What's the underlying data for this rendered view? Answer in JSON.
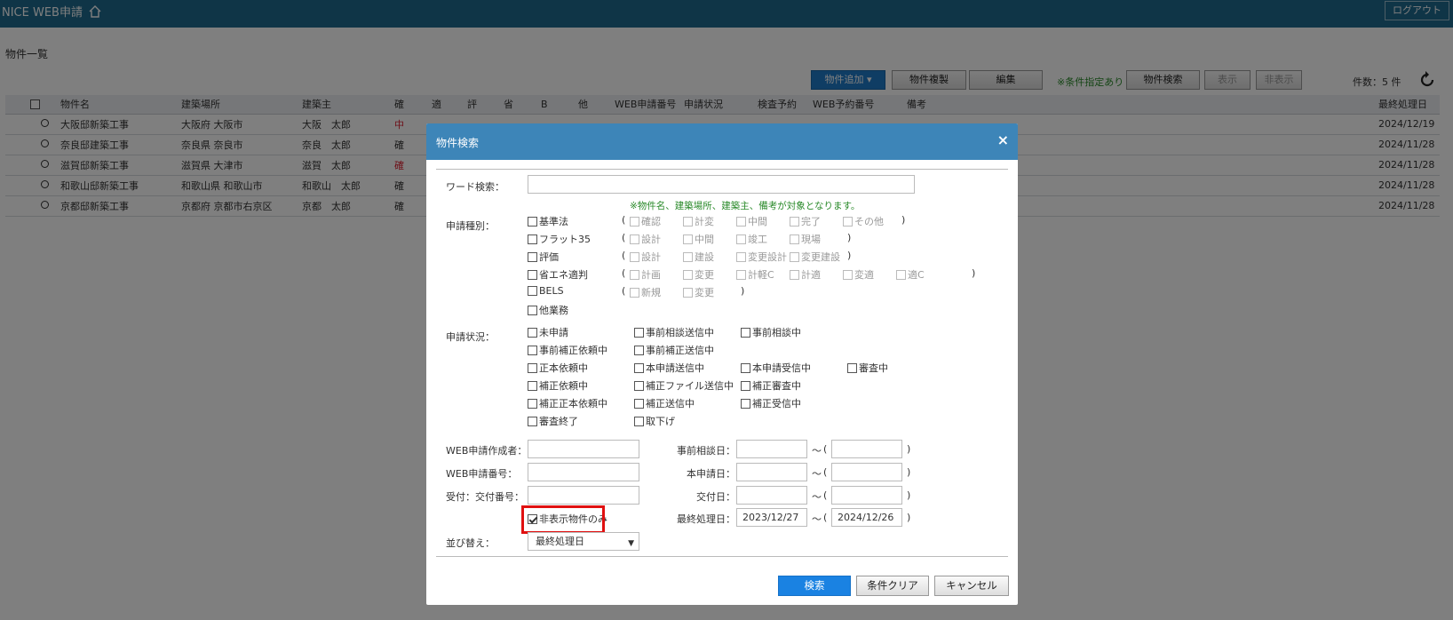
{
  "header": {
    "app_title": "NICE WEB申請",
    "home_icon": "home-icon",
    "logout": "ログアウト"
  },
  "page_title": "物件一覧",
  "toolbar": {
    "add": "物件追加",
    "copy": "物件複製",
    "edit": "編集",
    "condition_note": "※条件指定あり",
    "search": "物件検索",
    "show": "表示",
    "hide": "非表示",
    "count": "件数：5 件",
    "refresh_icon": "refresh-icon"
  },
  "table": {
    "columns": [
      "物件名",
      "建築場所",
      "建築主",
      "確",
      "適",
      "評",
      "省",
      "B",
      "他",
      "WEB申請番号",
      "申請状況",
      "検査予約",
      "WEB予約番号",
      "備考",
      "最終処理日"
    ],
    "rows": [
      {
        "name": "大阪邸新築工事",
        "place": "大阪府 大阪市",
        "owner": "大阪　太郎",
        "kaku": "中",
        "kaku_red": true,
        "date": "2024/12/19"
      },
      {
        "name": "奈良邸建築工事",
        "place": "奈良県 奈良市",
        "owner": "奈良　太郎",
        "kaku": "確",
        "kaku_red": false,
        "date": "2024/11/28"
      },
      {
        "name": "滋賀邸新築工事",
        "place": "滋賀県 大津市",
        "owner": "滋賀　太郎",
        "kaku": "確",
        "kaku_red": true,
        "date": "2024/11/28"
      },
      {
        "name": "和歌山邸新築工事",
        "place": "和歌山県 和歌山市",
        "owner": "和歌山　太郎",
        "kaku": "確",
        "kaku_red": false,
        "date": "2024/11/28"
      },
      {
        "name": "京都邸新築工事",
        "place": "京都府 京都市右京区",
        "owner": "京都　太郎",
        "kaku": "確",
        "kaku_red": false,
        "date": "2024/11/28"
      }
    ]
  },
  "dialog": {
    "title": "物件検索",
    "close": "×",
    "word_search_label": "ワード検索：",
    "word_search_value": "",
    "word_note": "※物件名、建築場所、建築主、備考が対象となります。",
    "app_type_label": "申請種別：",
    "app_types": [
      {
        "label": "基準法",
        "subs": [
          "確認",
          "計変",
          "中間",
          "完了",
          "その他"
        ]
      },
      {
        "label": "フラット35",
        "subs": [
          "設計",
          "中間",
          "竣工",
          "現場"
        ]
      },
      {
        "label": "評価",
        "subs": [
          "設計",
          "建設",
          "変更設計",
          "変更建設"
        ]
      },
      {
        "label": "省エネ適判",
        "subs": [
          "計画",
          "変更",
          "計軽C",
          "計適",
          "変適",
          "適C"
        ]
      },
      {
        "label": "BELS",
        "subs": [
          "新規",
          "変更"
        ]
      },
      {
        "label": "他業務",
        "subs": []
      }
    ],
    "status_label": "申請状況：",
    "statuses": [
      [
        "未申請",
        "事前相談送信中",
        "事前相談中"
      ],
      [
        "事前補正依頼中",
        "事前補正送信中"
      ],
      [
        "正本依頼中",
        "本申請送信中",
        "本申請受信中",
        "審査中"
      ],
      [
        "補正依頼中",
        "補正ファイル送信中",
        "補正審査中"
      ],
      [
        "補正正本依頼中",
        "補正送信中",
        "補正受信中"
      ],
      [
        "審査終了",
        "取下げ"
      ]
    ],
    "creator_label": "WEB申請作成者：",
    "appno_label": "WEB申請番号：",
    "receipt_label": "受付：交付番号：",
    "hidden_only_label": "非表示物件のみ",
    "hidden_only_checked": true,
    "sort_label": "並び替え：",
    "sort_value": "最終処理日",
    "pre_consult_label": "事前相談日：",
    "main_app_label": "本申請日：",
    "issue_label": "交付日：",
    "last_proc_label": "最終処理日：",
    "last_from": "2023/12/27",
    "last_to": "2024/12/26",
    "tilde": "～",
    "open_paren": "(",
    "close_paren": ")",
    "search_btn": "検索",
    "clear_btn": "条件クリア",
    "cancel_btn": "キャンセル"
  }
}
